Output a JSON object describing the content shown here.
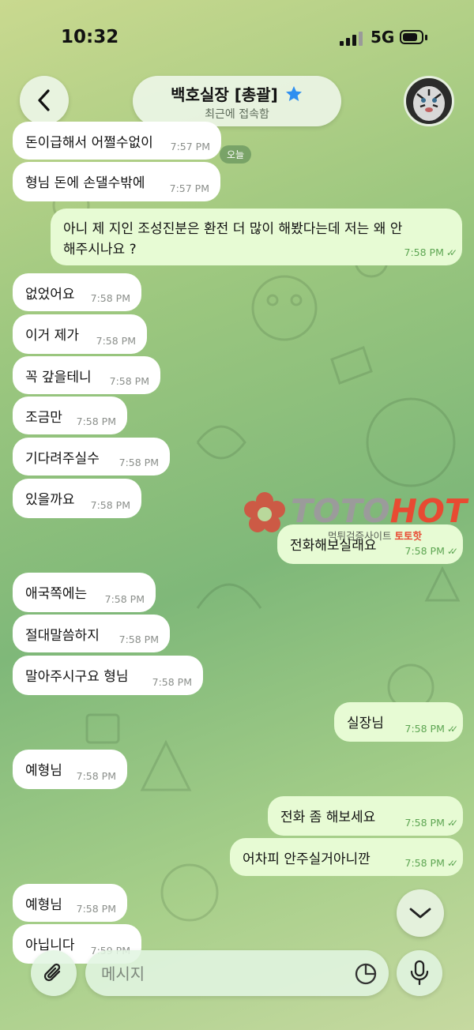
{
  "status_bar": {
    "time": "10:32",
    "network": "5G"
  },
  "header": {
    "title": "백호실장 [총괄]",
    "subtitle": "최근에 접속함"
  },
  "date_badge": "오늘",
  "messages": [
    {
      "text": "돈이급해서 어쩔수없이",
      "time": "7:57 PM",
      "dir": "in"
    },
    {
      "text": "형님 돈에 손댈수밖에",
      "time": "7:57 PM",
      "dir": "in"
    },
    {
      "text": "아니 제 지인 조성진분은 환전 더 많이 해봤다는데 저는 왜 안",
      "text2": "해주시나요 ?",
      "time": "7:58 PM",
      "dir": "out"
    },
    {
      "text": "없었어요",
      "time": "7:58 PM",
      "dir": "in"
    },
    {
      "text": "이거 제가",
      "time": "7:58 PM",
      "dir": "in"
    },
    {
      "text": "꼭 갚을테니",
      "time": "7:58 PM",
      "dir": "in"
    },
    {
      "text": "조금만",
      "time": "7:58 PM",
      "dir": "in"
    },
    {
      "text": "기다려주실수",
      "time": "7:58 PM",
      "dir": "in"
    },
    {
      "text": "있을까요",
      "time": "7:58 PM",
      "dir": "in"
    },
    {
      "text": "전화해보실래요",
      "time": "7:58 PM",
      "dir": "out"
    },
    {
      "text": "애국쪽에는",
      "time": "7:58 PM",
      "dir": "in"
    },
    {
      "text": "절대말씀하지",
      "time": "7:58 PM",
      "dir": "in"
    },
    {
      "text": "말아주시구요 형님",
      "time": "7:58 PM",
      "dir": "in"
    },
    {
      "text": "실장님",
      "time": "7:58 PM",
      "dir": "out"
    },
    {
      "text": "예형님",
      "time": "7:58 PM",
      "dir": "in"
    },
    {
      "text": "전화 좀 해보세요",
      "time": "7:58 PM",
      "dir": "out"
    },
    {
      "text": "어차피 안주실거아니깐",
      "time": "7:58 PM",
      "dir": "out"
    },
    {
      "text": "예형님",
      "time": "7:58 PM",
      "dir": "in"
    },
    {
      "text": "아닙니다",
      "time": "7:59 PM",
      "dir": "in"
    }
  ],
  "watermark": {
    "brand_a": "TOTO",
    "brand_b": "HOT",
    "sub_a": "먹튀검증사이트",
    "sub_b": "토토핫"
  },
  "composer": {
    "placeholder": "메시지"
  }
}
